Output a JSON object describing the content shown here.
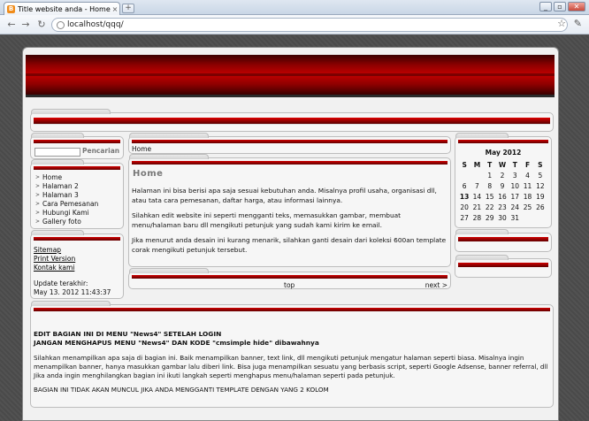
{
  "browser": {
    "tab_title": "Title website anda - Home",
    "tab_close": "×",
    "new_tab": "+",
    "url": "localhost/qqq/",
    "back": "←",
    "forward": "→",
    "reload": "↻",
    "minimize": "_",
    "maximize": "▫",
    "close": "✕",
    "favicon_letter": "B"
  },
  "search": {
    "button_label": "Pencarian",
    "placeholder": ""
  },
  "menu": {
    "items": [
      "Home",
      "Halaman 2",
      "Halaman 3",
      "Cara Pemesanan",
      "Hubungi Kami",
      "Gallery foto"
    ]
  },
  "links": {
    "sitemap": "Sitemap",
    "print": "Print Version",
    "contact": "Kontak kami"
  },
  "update": {
    "label": "Update terakhir:",
    "value": "May 13. 2012 11:43:37"
  },
  "breadcrumb": "Home",
  "main": {
    "heading": "Home",
    "p1": "Halaman ini bisa berisi apa saja sesuai kebutuhan anda. Misalnya profil usaha, organisasi dll, atau tata cara pemesanan, daftar harga, atau informasi lainnya.",
    "p2": "Silahkan edit website ini seperti mengganti teks, memasukkan gambar, membuat menu/halaman baru dll mengikuti petunjuk yang sudah kami kirim ke email.",
    "p3": "Jika menurut anda desain ini kurang menarik, silahkan ganti desain dari koleksi 600an template corak mengikuti petunjuk tersebut."
  },
  "pager": {
    "top": "top",
    "next": "next >"
  },
  "calendar": {
    "title": "May 2012",
    "days": [
      "S",
      "M",
      "T",
      "W",
      "T",
      "F",
      "S"
    ],
    "cells": [
      "",
      "",
      "1",
      "2",
      "3",
      "4",
      "5",
      "6",
      "7",
      "8",
      "9",
      "10",
      "11",
      "12",
      "13",
      "14",
      "15",
      "16",
      "17",
      "18",
      "19",
      "20",
      "21",
      "22",
      "23",
      "24",
      "25",
      "26",
      "27",
      "28",
      "29",
      "30",
      "31",
      "",
      ""
    ]
  },
  "bottom": {
    "line1": "EDIT BAGIAN INI DI MENU \"News4\" SETELAH LOGIN",
    "line2": "JANGAN MENGHAPUS MENU \"News4\" DAN KODE \"cmsimple hide\" dibawahnya",
    "para": "Silahkan menampilkan apa saja di bagian ini. Baik menampilkan banner, text link, dll mengikuti petunjuk mengatur halaman seperti biasa. Misalnya ingin menampilkan banner, hanya masukkan gambar lalu diberi link. Bisa juga menampilkan sesuatu yang berbasis script, seperti Google Adsense, banner referral, dll Jika anda ingin menghilangkan bagian ini ikuti langkah seperti menghapus menu/halaman seperti pada petunjuk.",
    "line3": "BAGIAN INI TIDAK AKAN MUNCUL JIKA ANDA MENGGANTI TEMPLATE DENGAN YANG 2 KOLOM"
  }
}
